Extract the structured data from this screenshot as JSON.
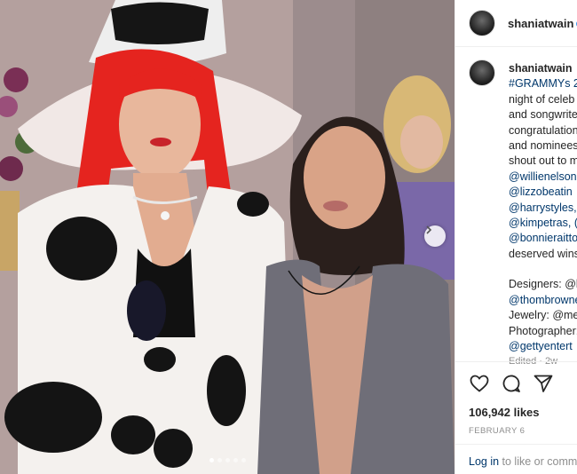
{
  "post": {
    "username": "shaniatwain",
    "caption_lines": [
      "#GRAMMYs 2",
      "night of celeb",
      "and songwrite",
      "congratulation",
      "and nominees",
      "shout out to m"
    ],
    "mention_lines": [
      "@willienelson",
      "@lizzobeatin",
      "@harrystyles,",
      "@kimpetras, (",
      "@bonnieraitto",
      "deserved wins"
    ],
    "credits": {
      "designers_label": "Designers: @l",
      "designers_handle": "@thombrowne",
      "jewelry": "Jewelry: @me",
      "photographer": "Photographer:",
      "photographer_handle": "@gettyentert"
    },
    "edited": "Edited · 2w",
    "likes": "106,942 likes",
    "date": "FEBRUARY 6",
    "login_link": "Log in",
    "login_rest": " to like or comm"
  },
  "icons": {
    "like": "heart-icon",
    "comment": "comment-icon",
    "share": "share-icon",
    "next": "chevron-right-icon"
  },
  "colors": {
    "link": "#00376b",
    "muted": "#8e8e8e",
    "verified": "#3897f0"
  }
}
